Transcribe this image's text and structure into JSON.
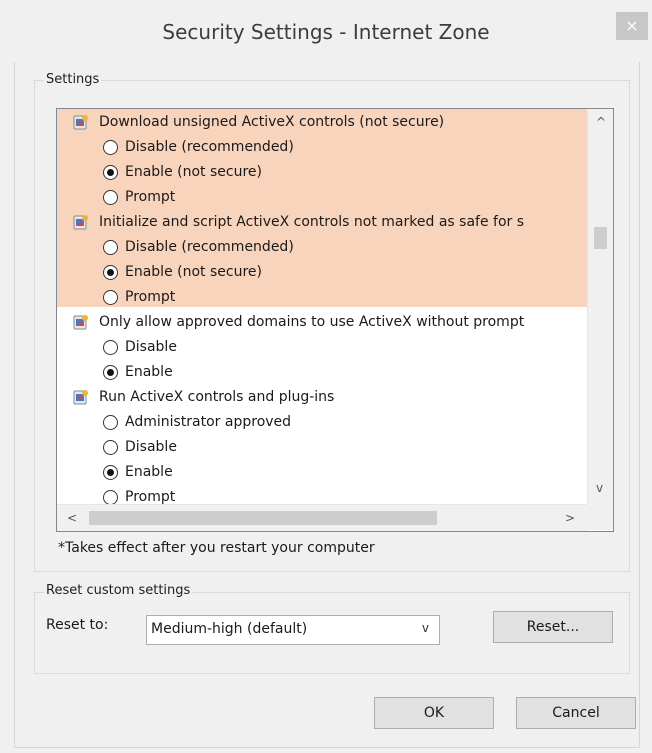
{
  "window": {
    "title": "Security Settings - Internet Zone",
    "close_glyph": "×"
  },
  "settings": {
    "group_label": "Settings",
    "items": [
      {
        "text": "Download unsigned ActiveX controls (not secure)",
        "kind": "header",
        "icon": "activex-settings-icon",
        "highlighted": true
      },
      {
        "text": "Disable (recommended)",
        "kind": "radio",
        "checked": false,
        "highlighted": true
      },
      {
        "text": "Enable (not secure)",
        "kind": "radio",
        "checked": true,
        "highlighted": true
      },
      {
        "text": "Prompt",
        "kind": "radio",
        "checked": false,
        "highlighted": true
      },
      {
        "text": "Initialize and script ActiveX controls not marked as safe for s",
        "kind": "header",
        "icon": "activex-settings-icon",
        "highlighted": true
      },
      {
        "text": "Disable (recommended)",
        "kind": "radio",
        "checked": false,
        "highlighted": true
      },
      {
        "text": "Enable (not secure)",
        "kind": "radio",
        "checked": true,
        "highlighted": true
      },
      {
        "text": "Prompt",
        "kind": "radio",
        "checked": false,
        "highlighted": true
      },
      {
        "text": "Only allow approved domains to use ActiveX without prompt",
        "kind": "header",
        "icon": "activex-settings-icon",
        "highlighted": false
      },
      {
        "text": "Disable",
        "kind": "radio",
        "checked": false,
        "highlighted": false
      },
      {
        "text": "Enable",
        "kind": "radio",
        "checked": true,
        "highlighted": false
      },
      {
        "text": "Run ActiveX controls and plug-ins",
        "kind": "header",
        "icon": "activex-settings-icon",
        "highlighted": false
      },
      {
        "text": "Administrator approved",
        "kind": "radio",
        "checked": false,
        "highlighted": false
      },
      {
        "text": "Disable",
        "kind": "radio",
        "checked": false,
        "highlighted": false
      },
      {
        "text": "Enable",
        "kind": "radio",
        "checked": true,
        "highlighted": false
      },
      {
        "text": "Prompt",
        "kind": "radio",
        "checked": false,
        "highlighted": false
      }
    ],
    "highlight_color": "#f9d4bd",
    "scroll_up": "^",
    "scroll_down": "v",
    "scroll_left": "<",
    "scroll_right": ">"
  },
  "note": "*Takes effect after you restart your computer",
  "reset": {
    "group_label": "Reset custom settings",
    "label": "Reset to:",
    "selected": "Medium-high (default)",
    "chevron": "v",
    "button": "Reset..."
  },
  "footer": {
    "ok": "OK",
    "cancel": "Cancel"
  }
}
